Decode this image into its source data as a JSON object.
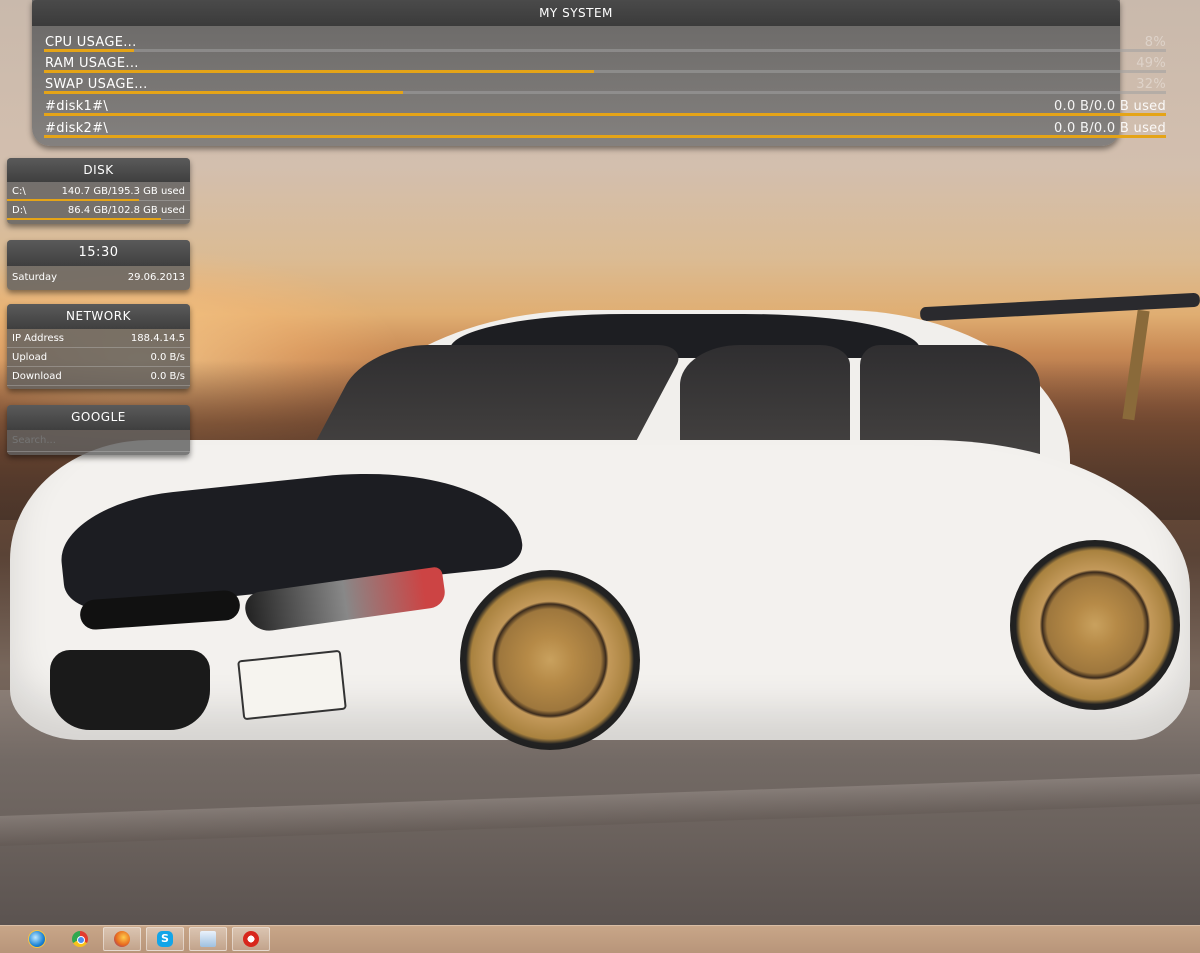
{
  "system_widget": {
    "title": "MY SYSTEM",
    "rows": [
      {
        "label": "CPU USAGE...",
        "value": "8%",
        "fill": 0.08
      },
      {
        "label": "RAM USAGE...",
        "value": "49%",
        "fill": 0.49
      },
      {
        "label": "SWAP USAGE...",
        "value": "32%",
        "fill": 0.32
      },
      {
        "label": "#disk1#\\",
        "value": "0.0 B/0.0 B used",
        "fill": 1.0
      },
      {
        "label": "#disk2#\\",
        "value": "0.0 B/0.0 B used",
        "fill": 1.0
      }
    ],
    "accent": "#e5a417"
  },
  "disk_widget": {
    "title": "DISK",
    "rows": [
      {
        "label": "C:\\",
        "value": "140.7 GB/195.3 GB used",
        "fill": 0.72
      },
      {
        "label": "D:\\",
        "value": "86.4 GB/102.8 GB used",
        "fill": 0.84
      }
    ]
  },
  "clock_widget": {
    "time": "15:30",
    "day": "Saturday",
    "date": "29.06.2013"
  },
  "network_widget": {
    "title": "NETWORK",
    "rows": [
      {
        "label": "IP Address",
        "value": "188.4.14.5"
      },
      {
        "label": "Upload",
        "value": "0.0 B/s"
      },
      {
        "label": "Download",
        "value": "0.0 B/s"
      }
    ]
  },
  "google_widget": {
    "title": "GOOGLE",
    "placeholder": "Search..."
  },
  "taskbar": {
    "apps": [
      {
        "icon": "internet-explorer-icon",
        "active": false
      },
      {
        "icon": "chrome-icon",
        "active": false
      },
      {
        "icon": "firefox-icon",
        "active": true
      },
      {
        "icon": "skype-icon",
        "active": true,
        "glyph": "S"
      },
      {
        "icon": "notepad-icon",
        "active": true
      },
      {
        "icon": "opera-icon",
        "active": true
      }
    ]
  }
}
